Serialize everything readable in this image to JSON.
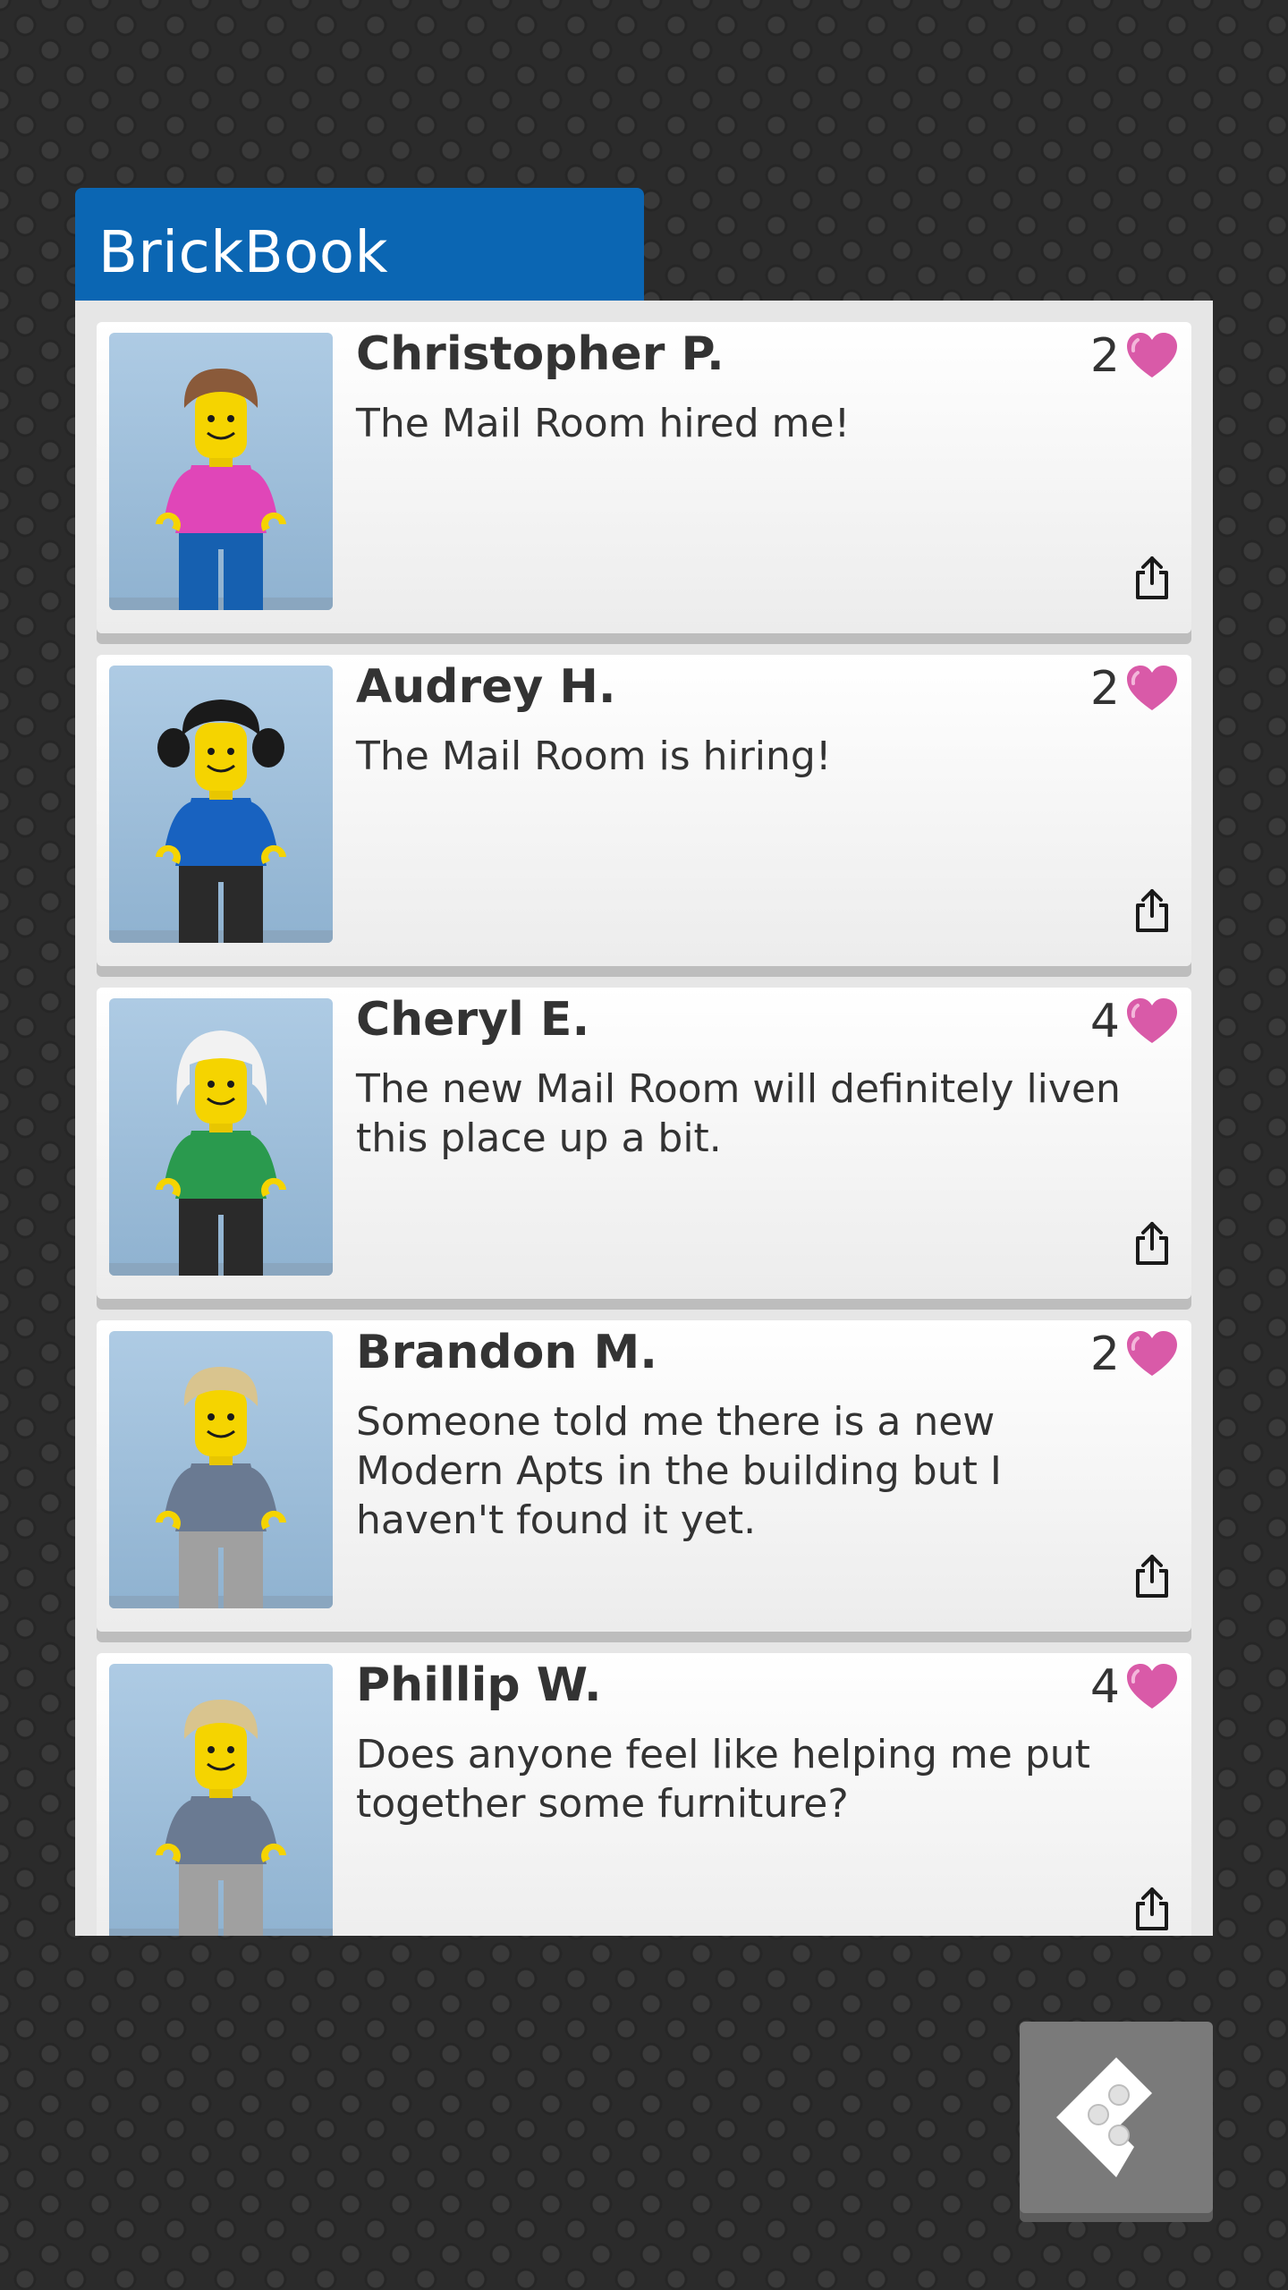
{
  "app": {
    "title": "BrickBook"
  },
  "feed": [
    {
      "name": "Christopher P.",
      "likes": "2",
      "message": "The Mail Room hired me!",
      "avatar": {
        "hair": "#8a5a3a",
        "torso": "#e046b8",
        "legs": "#1660b0",
        "hair_style": "short"
      }
    },
    {
      "name": "Audrey H.",
      "likes": "2",
      "message": "The Mail Room is hiring!",
      "avatar": {
        "hair": "#1a1a1a",
        "torso": "#1862c0",
        "legs": "#2a2a2a",
        "hair_style": "pigtails"
      }
    },
    {
      "name": "Cheryl E.",
      "likes": "4",
      "message": "The new Mail Room will definitely liven this place up a bit.",
      "avatar": {
        "hair": "#f2f2f2",
        "torso": "#2a9a4e",
        "legs": "#2a2a2a",
        "hair_style": "long"
      }
    },
    {
      "name": "Brandon M.",
      "likes": "2",
      "message": "Someone told me there is a new Modern Apts in the building but I haven't found it yet.",
      "avatar": {
        "hair": "#d9c48e",
        "torso": "#6a7a92",
        "legs": "#a0a0a0",
        "hair_style": "short"
      }
    },
    {
      "name": "Phillip W.",
      "likes": "4",
      "message": "Does anyone feel like helping me put together some furniture?",
      "avatar": {
        "hair": "#d9c48e",
        "torso": "#6a7a92",
        "legs": "#a0a0a0",
        "hair_style": "short"
      }
    }
  ],
  "icons": {
    "like": "heart-icon",
    "share": "share-icon",
    "back": "back-brick-icon"
  },
  "colors": {
    "header": "#0b66b3",
    "heart": "#d95aa8"
  }
}
